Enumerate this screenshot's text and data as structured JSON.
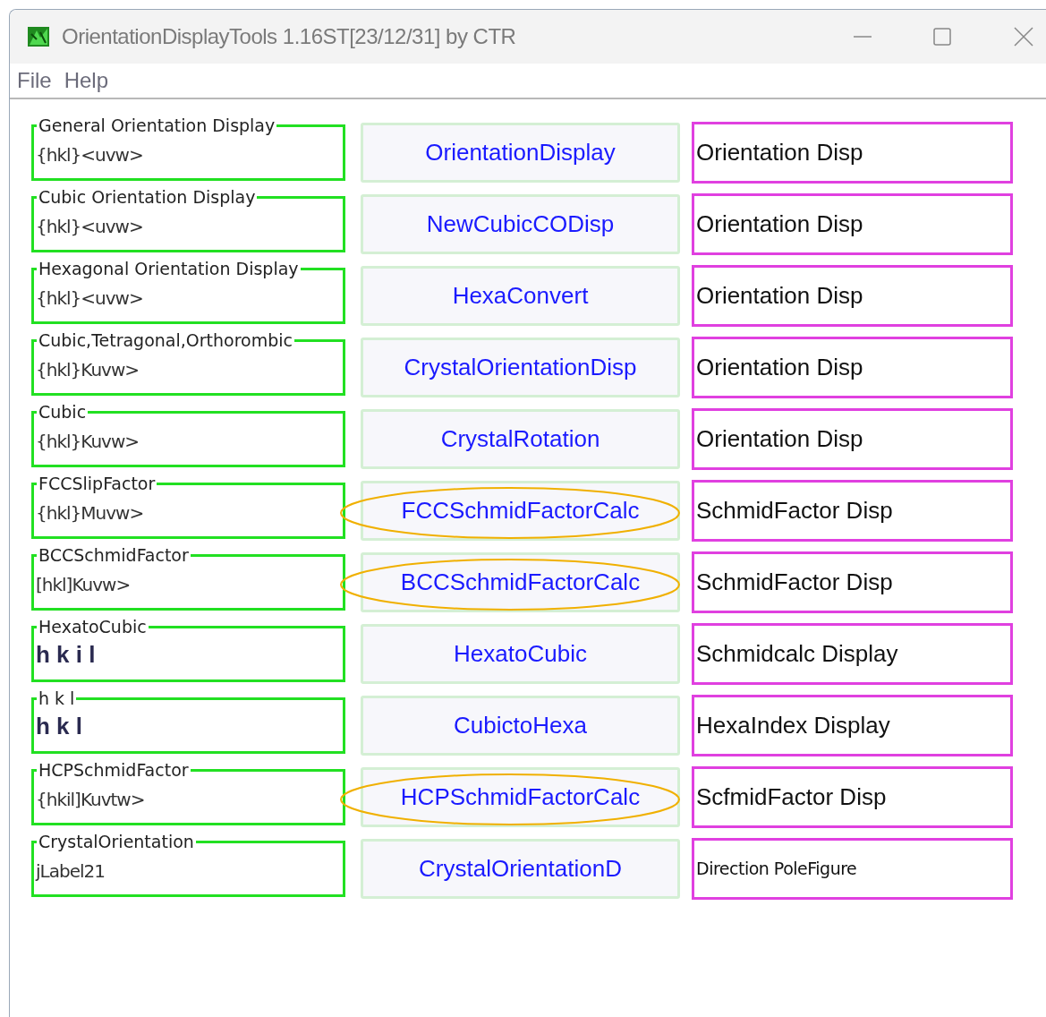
{
  "window": {
    "title": "OrientationDisplayTools 1.16ST[23/12/31] by CTR"
  },
  "menu": [
    "File",
    "Help"
  ],
  "rows": [
    {
      "group": "General Orientation Display",
      "value": "{hkl}<uvw>",
      "emphasized": false,
      "button": "OrientationDisplay",
      "circled": false,
      "display": "Orientation Disp",
      "small": false
    },
    {
      "group": "Cubic Orientation Display",
      "value": "{hkl}<uvw>",
      "emphasized": false,
      "button": "NewCubicCODisp",
      "circled": false,
      "display": "Orientation Disp",
      "small": false
    },
    {
      "group": "Hexagonal Orientation Display",
      "value": "{hkl}<uvw>",
      "emphasized": false,
      "button": "HexaConvert",
      "circled": false,
      "display": "Orientation Disp",
      "small": false
    },
    {
      "group": "Cubic,Tetragonal,Orthorombic",
      "value": "{hkl}Kuvw>",
      "emphasized": false,
      "button": "CrystalOrientationDisp",
      "circled": false,
      "display": "Orientation Disp",
      "small": false
    },
    {
      "group": "Cubic",
      "value": "{hkl}Kuvw>",
      "emphasized": false,
      "button": "CrystalRotation",
      "circled": false,
      "display": "Orientation Disp",
      "small": false
    },
    {
      "group": "FCCSlipFactor",
      "value": "{hkl}Muvw>",
      "emphasized": false,
      "button": "FCCSchmidFactorCalc",
      "circled": true,
      "display": "SchmidFactor Disp",
      "small": false
    },
    {
      "group": "BCCSchmidFactor",
      "value": "[hkl]Kuvw>",
      "emphasized": false,
      "button": "BCCSchmidFactorCalc",
      "circled": true,
      "display": "SchmidFactor Disp",
      "small": false
    },
    {
      "group": "HexatoCubic",
      "value": "h k i l",
      "emphasized": true,
      "button": "HexatoCubic",
      "circled": false,
      "display": "Schmidcalc Display",
      "small": false
    },
    {
      "group": "h k l",
      "value": "h k l",
      "emphasized": true,
      "button": "CubictoHexa",
      "circled": false,
      "display": "HexaIndex Display",
      "small": false
    },
    {
      "group": "HCPSchmidFactor",
      "value": "{hkil]Kuvtw>",
      "emphasized": false,
      "button": "HCPSchmidFactorCalc",
      "circled": true,
      "display": "ScfmidFactor Disp",
      "small": false
    },
    {
      "group": "CrystalOrientation",
      "value": "jLabel21",
      "emphasized": false,
      "button": "CrystalOrientationD",
      "circled": false,
      "display": "Direction PoleFigure",
      "small": true
    }
  ]
}
